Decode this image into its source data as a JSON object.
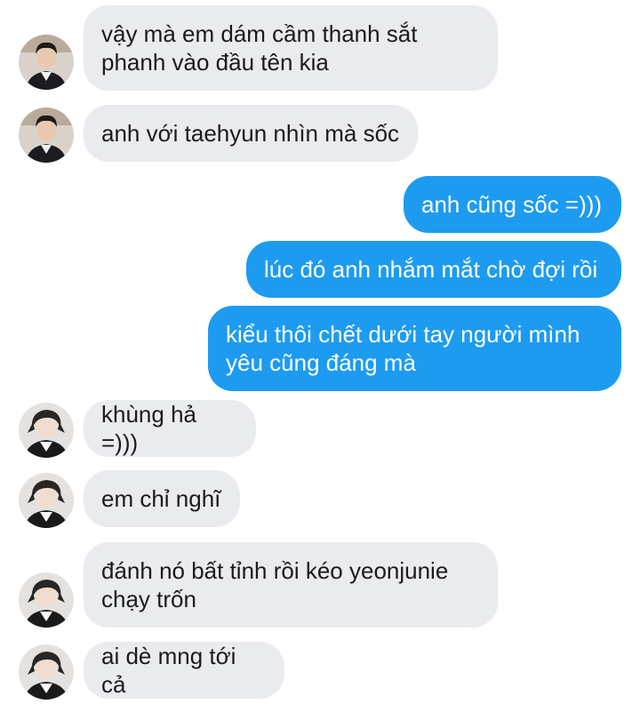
{
  "conversation": {
    "messages": [
      {
        "sender": "contact-a",
        "direction": "incoming",
        "text": "vậy mà em dám cầm thanh sắt\nphanh vào đầu tên kia"
      },
      {
        "sender": "contact-a",
        "direction": "incoming",
        "text": "anh với taehyun nhìn mà sốc"
      },
      {
        "sender": "me",
        "direction": "outgoing",
        "text": "anh cũng sốc =)))"
      },
      {
        "sender": "me",
        "direction": "outgoing",
        "text": "lúc đó anh nhắm mắt chờ đợi rồi"
      },
      {
        "sender": "me",
        "direction": "outgoing",
        "text": "kiểu thôi chết dưới tay người mình\nyêu cũng đáng mà"
      },
      {
        "sender": "contact-b",
        "direction": "incoming",
        "text": "khùng hả =)))"
      },
      {
        "sender": "contact-b",
        "direction": "incoming",
        "text": "em chỉ nghĩ"
      },
      {
        "sender": "contact-b",
        "direction": "incoming",
        "text": "đánh nó bất tỉnh rồi kéo yeonjunie\nchạy trốn"
      },
      {
        "sender": "contact-b",
        "direction": "incoming",
        "text": "ai dè mng tới cả"
      }
    ]
  },
  "avatars": {
    "contact-a": {
      "icon": "profile-photo-icon"
    },
    "contact-b": {
      "icon": "profile-photo-icon"
    }
  },
  "colors": {
    "incoming_bubble": "#e9ebef",
    "outgoing_bubble": "#1d9bf0",
    "incoming_text": "#1b1b1b",
    "outgoing_text": "#ffffff"
  }
}
